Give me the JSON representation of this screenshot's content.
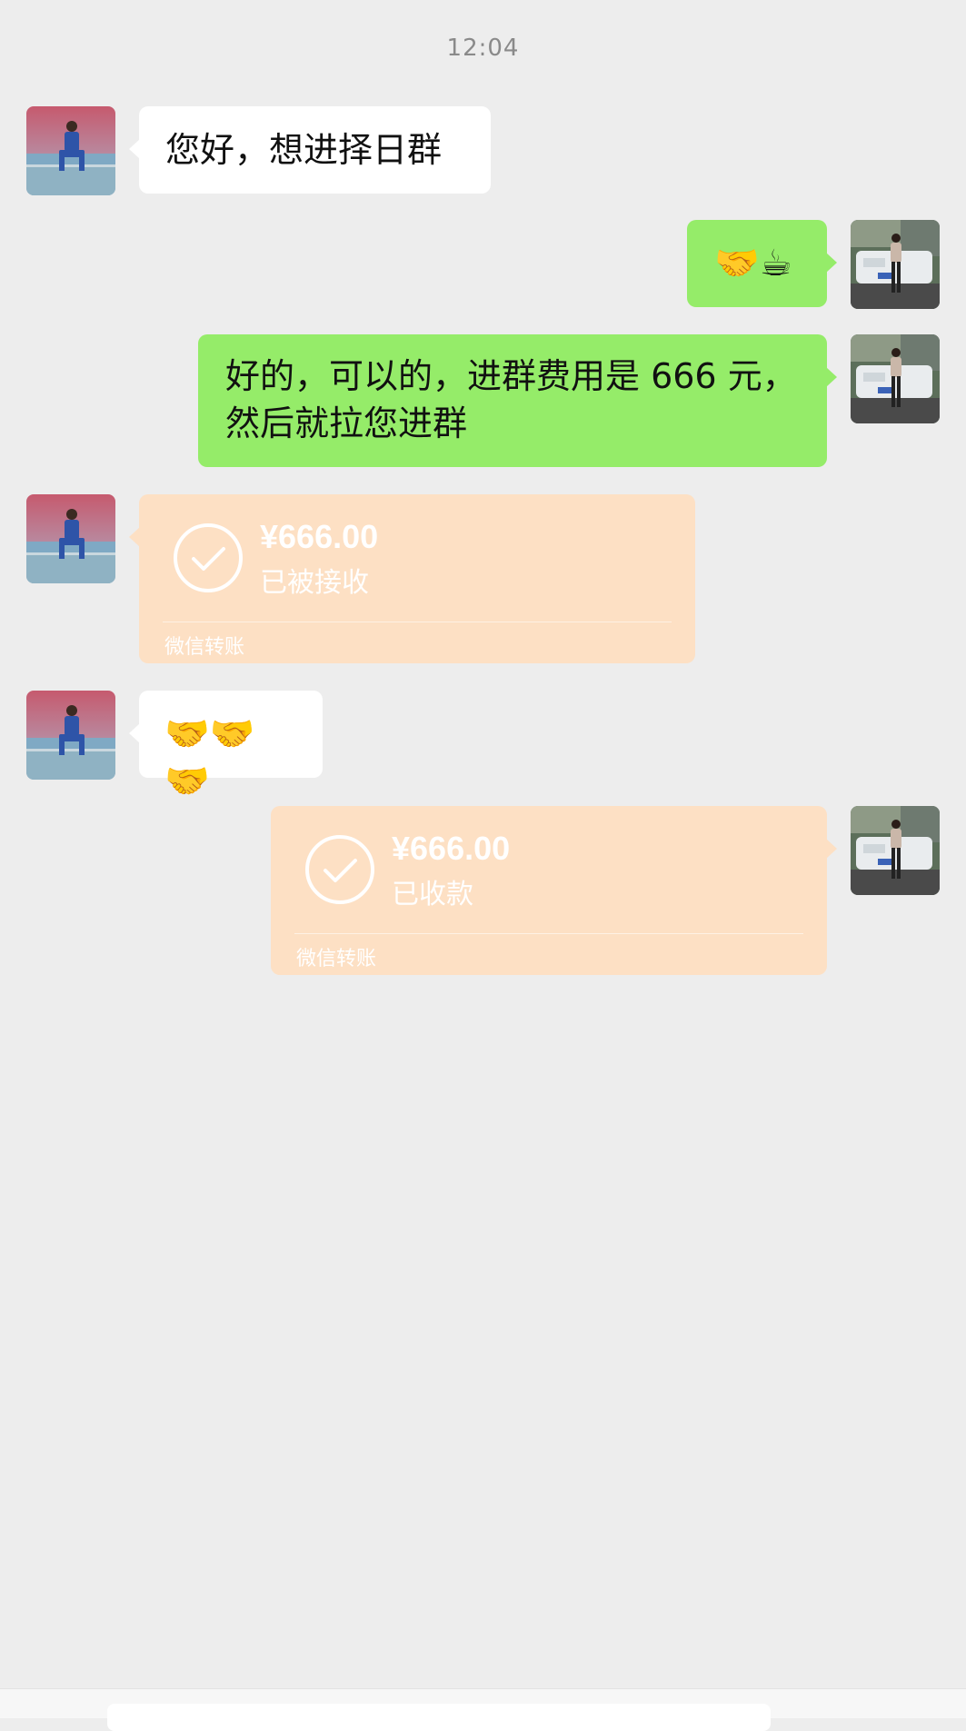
{
  "chat": {
    "timestamp": "12:04",
    "messages": [
      {
        "side": "left",
        "type": "text",
        "text": "您好，想进择日群"
      },
      {
        "side": "right",
        "type": "emoji",
        "text": "🤝☕"
      },
      {
        "side": "right",
        "type": "text",
        "line1": "好的，可以的，进群费用是 666 元，",
        "line2": "然后就拉您进群"
      },
      {
        "side": "left",
        "type": "transfer",
        "amount": "¥666.00",
        "status": "已被接收",
        "footer": "微信转账"
      },
      {
        "side": "left",
        "type": "emoji",
        "text": "🤝🤝🤝"
      },
      {
        "side": "right",
        "type": "transfer",
        "amount": "¥666.00",
        "status": "已收款",
        "footer": "微信转账"
      }
    ]
  },
  "colors": {
    "background": "#ededed",
    "bubble_self": "#95ec69",
    "bubble_other": "#ffffff",
    "transfer_card": "#fde0c4"
  }
}
